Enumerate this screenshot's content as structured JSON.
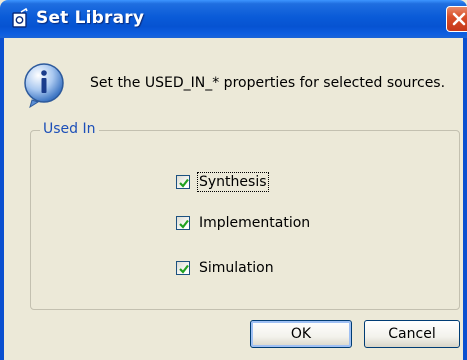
{
  "window": {
    "title": "Set Library",
    "close_label": "Close"
  },
  "message": {
    "text": "Set the USED_IN_* properties for selected sources."
  },
  "group": {
    "label": "Used In",
    "options": [
      {
        "label": "Synthesis",
        "checked": true
      },
      {
        "label": "Implementation",
        "checked": true
      },
      {
        "label": "Simulation",
        "checked": true
      }
    ]
  },
  "buttons": {
    "ok": "OK",
    "cancel": "Cancel"
  },
  "colors": {
    "titlebar": "#0a5bd8",
    "group_label": "#1c4fb8",
    "checkmark": "#21a121",
    "close": "#d9502a"
  },
  "icons": {
    "title": "app-icon",
    "info": "info-icon",
    "close": "close-icon",
    "check": "check-icon"
  }
}
